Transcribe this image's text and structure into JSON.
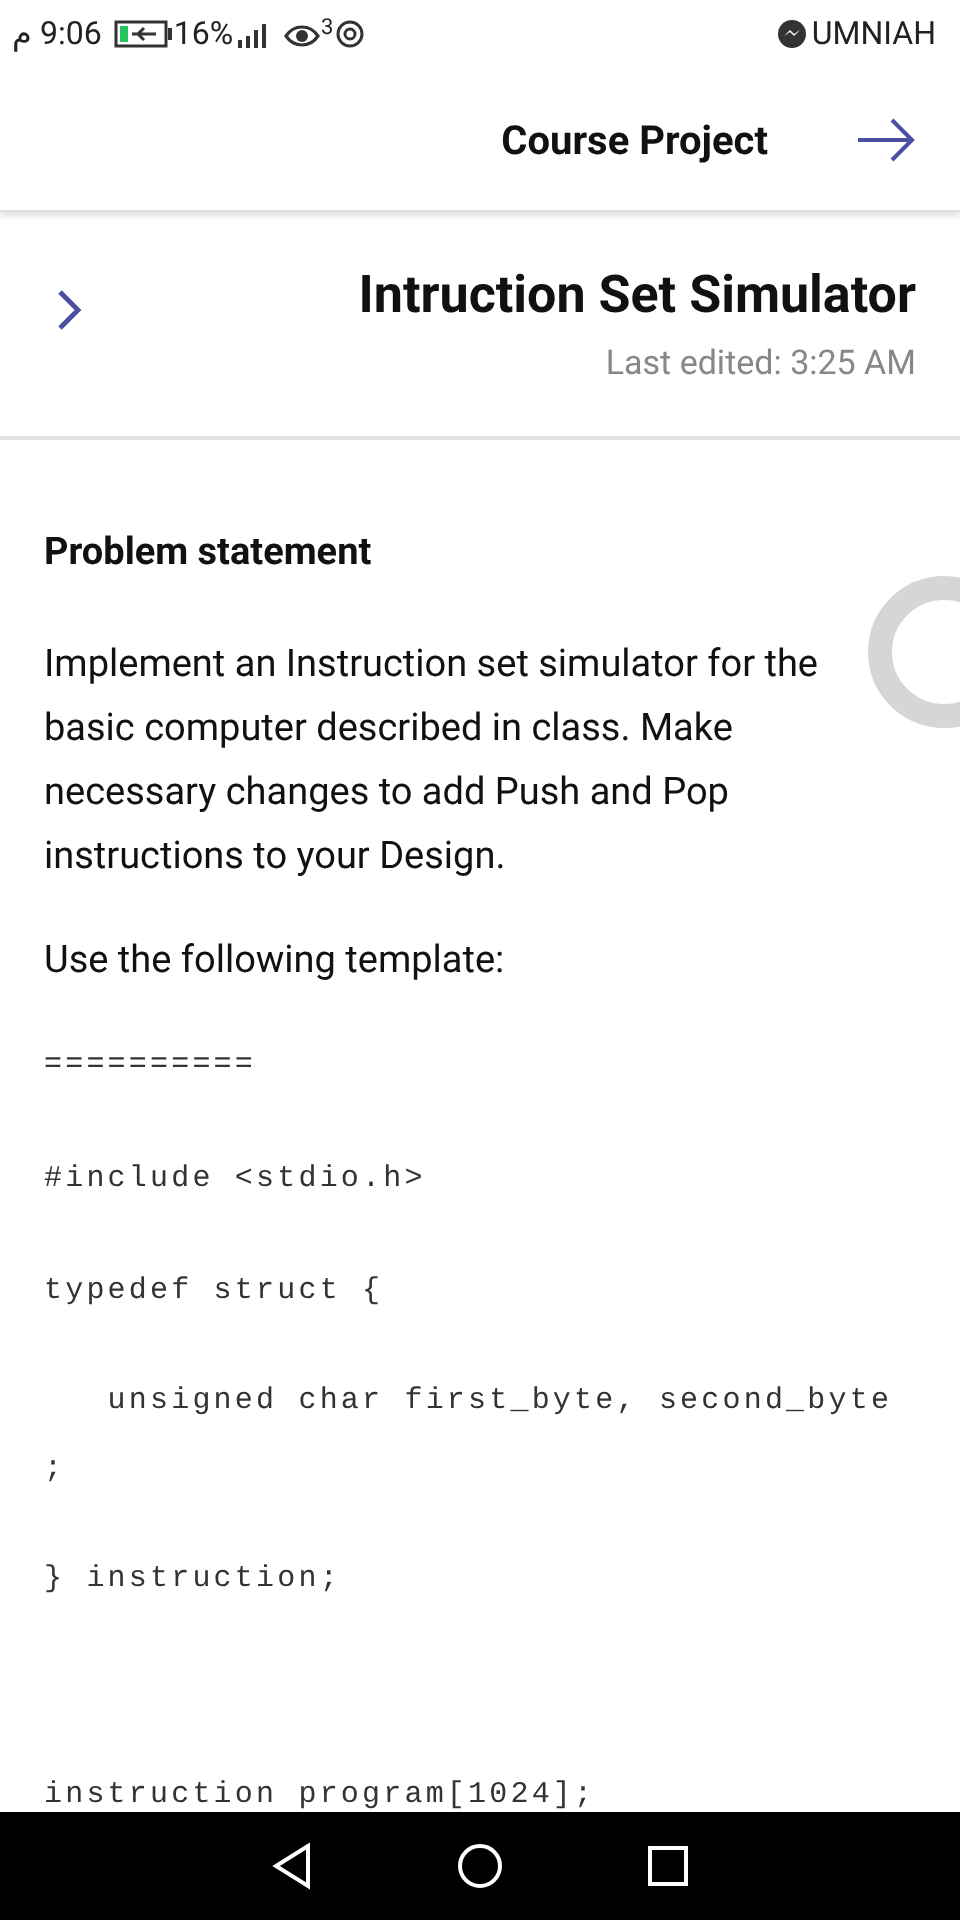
{
  "status_bar": {
    "time": "م 9:06",
    "battery": "16%",
    "notification_count": "3",
    "carrier": "UMNIAH"
  },
  "header": {
    "title": "Course Project"
  },
  "note": {
    "title": "Intruction Set Simulator",
    "edited": "Last edited: 3:25 AM"
  },
  "content": {
    "heading": "Problem statement",
    "paragraphs": [
      "Implement an Instruction set simulator for the basic computer described in class. Make necessary changes to add Push and Pop instructions to your Design.",
      "Use the following template:"
    ],
    "code_lines": [
      "==========",
      "#include <stdio.h>",
      "typedef struct {",
      "   unsigned char first_byte, second_byte",
      ";",
      "} instruction;",
      "instruction program[1024];"
    ]
  }
}
